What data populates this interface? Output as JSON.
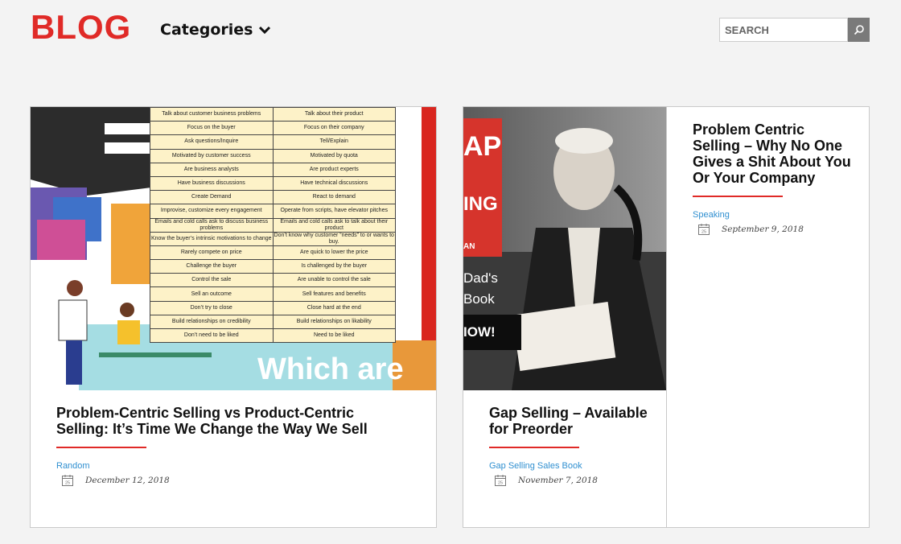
{
  "header": {
    "logo": "BLOG",
    "categories_label": "Categories",
    "search_placeholder": "SEARCH"
  },
  "posts": [
    {
      "title": "Problem-Centric Selling vs Product-Centric Selling: It’s Time We Change the Way We Sell",
      "category": "Random",
      "date": "December 12, 2018",
      "image": {
        "table_rows": [
          [
            "Talk about customer business problems",
            "Talk about their product"
          ],
          [
            "Focus on the buyer",
            "Focus on their company"
          ],
          [
            "Ask questions/Inquire",
            "Tell/Explain"
          ],
          [
            "Motivated by customer success",
            "Motivated by quota"
          ],
          [
            "Are business analysts",
            "Are product experts"
          ],
          [
            "Have business discussions",
            "Have technical discussions"
          ],
          [
            "Create Demand",
            "React to demand"
          ],
          [
            "Improvise, customize every engagement",
            "Operate from scripts, have elevator pitches"
          ],
          [
            "Emails and cold calls ask to discuss business problems",
            "Emails and cold calls ask to talk about their product"
          ],
          [
            "Know the buyer’s intrinsic motivations to change",
            "Don’t know why customer “needs” to or wants to buy."
          ],
          [
            "Rarely compete on price",
            "Are quick to lower the price"
          ],
          [
            "Challenge the buyer",
            "Is challenged by the buyer"
          ],
          [
            "Control the sale",
            "Are unable to control the sale"
          ],
          [
            "Sell an outcome",
            "Sell features and benefits"
          ],
          [
            "Don’t try to close",
            "Close hard at the end"
          ],
          [
            "Build relationships on credibility",
            "Build relationships on likability"
          ],
          [
            "Don’t need to be liked",
            "Need to be liked"
          ]
        ],
        "bottom_text": "Which are"
      }
    },
    {
      "title": "Gap Selling – Available for Preorder",
      "category": "Gap Selling Sales Book",
      "date": "November 7, 2018",
      "image": {
        "book_letters_top": "AP",
        "book_letters_mid": "ING",
        "book_letters_bot": "AN",
        "overlay_line1": "Dad's",
        "overlay_line2": "Book",
        "button_text": "IOW!"
      }
    },
    {
      "title": "Problem Centric Selling – Why No One Gives a Shit About You Or Your Company",
      "category": "Speaking",
      "date": "September 9, 2018"
    }
  ],
  "icons": {
    "calendar_day": "25"
  },
  "colors": {
    "brand_red": "#e02a27",
    "link_blue": "#2f8fd0"
  }
}
